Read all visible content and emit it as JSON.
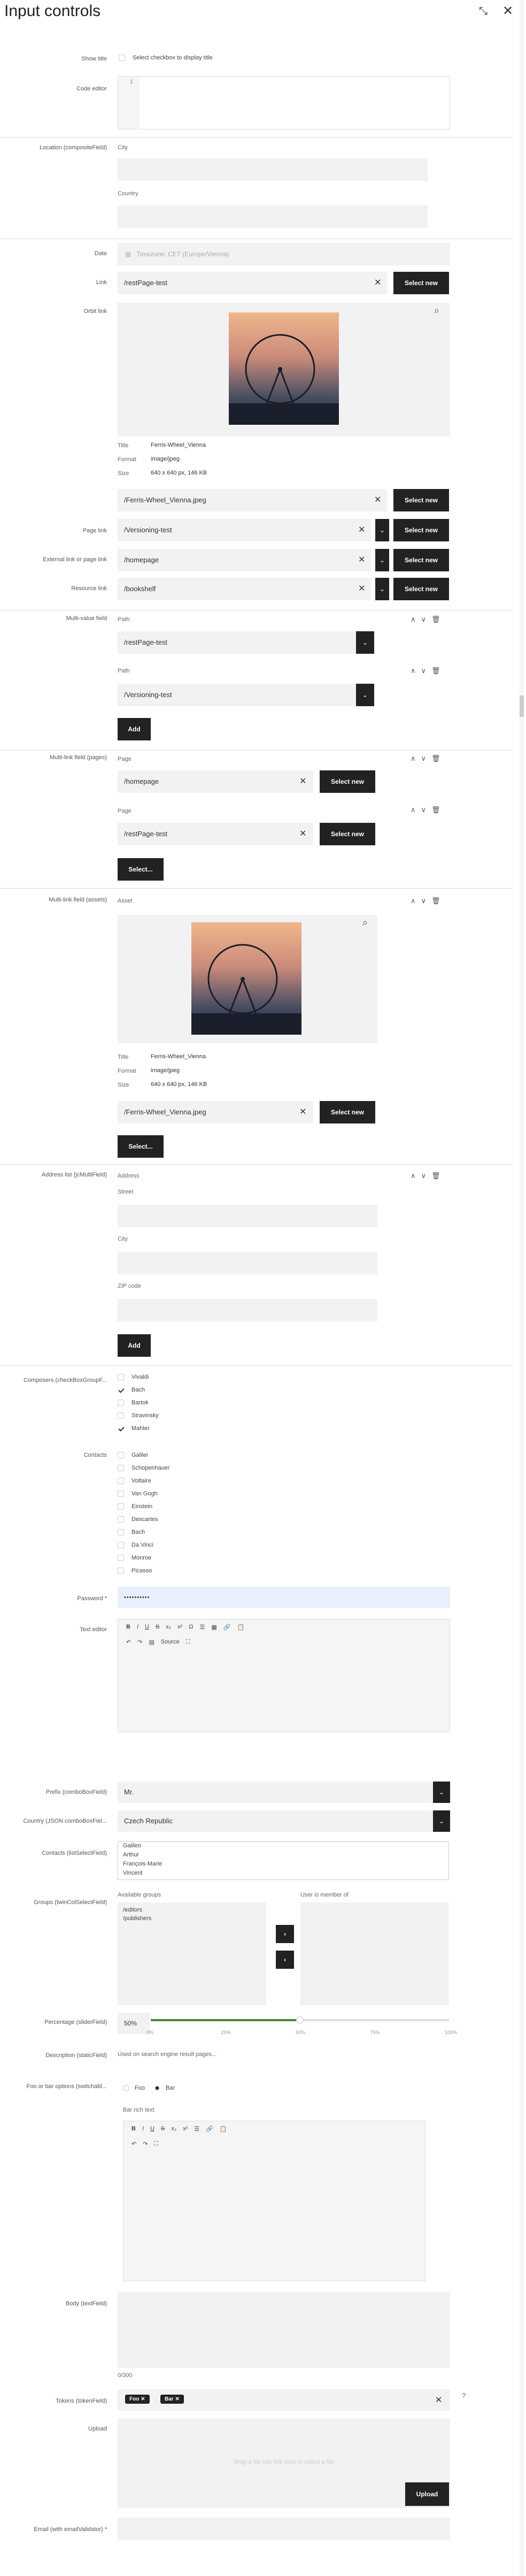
{
  "header": {
    "title": "Input controls"
  },
  "labels": {
    "show_title": "Show title",
    "code_editor": "Code editor",
    "location": "Location (compositeField)",
    "date": "Date",
    "link": "Link",
    "orbit_link": "Orbit link",
    "page_link": "Page link",
    "external_link": "External link or page link",
    "resource_link": "Resource link",
    "multivalue": "Multi-value field",
    "multilink_pages": "Multi-link field (pages)",
    "multilink_assets": "Multi-link field (assets)",
    "address_list": "Address list (jcMultiField)",
    "composers": "Composers (checkBoxGroupF...",
    "contacts": "Contacts",
    "password": "Password *",
    "text_editor": "Text editor",
    "prefix": "Prefix (comboBoxField)",
    "country": "Country (JSON comboBoxFiel...",
    "contacts_select": "Contacts (listSelectField)",
    "groups": "Groups (twinColSelectField)",
    "percentage": "Percentage (sliderField)",
    "description": "Description (staticField)",
    "foo_bar": "Foo or bar options (switchabl...",
    "body": "Body (textField)",
    "tokens": "Tokens (tokenField)",
    "upload": "Upload",
    "email": "Email (with emailValidator) *"
  },
  "show_title": {
    "checkbox_label": "Select checkbox to display title"
  },
  "code_editor": {
    "line": "1"
  },
  "location": {
    "city": "City",
    "country": "Country"
  },
  "date": {
    "placeholder": "Timezone: CET (Europe/Vienna)"
  },
  "link": {
    "value": "/restPage-test",
    "button": "Select new"
  },
  "asset": {
    "title_k": "Title",
    "title_v": "Ferris-Wheel_Vienna",
    "format_k": "Format",
    "format_v": "image/jpeg",
    "size_k": "Size",
    "size_v": "640 x 640 px, 146 KB",
    "path": "/Ferris-Wheel_Vienna.jpeg",
    "button": "Select new"
  },
  "page_link": {
    "value": "/Versioning-test",
    "button": "Select new"
  },
  "external_link": {
    "value": "/homepage",
    "button": "Select new"
  },
  "resource_link": {
    "value": "/bookshelf",
    "button": "Select new"
  },
  "multivalue": {
    "path1": "Path",
    "value1": "/restPage-test",
    "path2": "Path",
    "value2": "/Versioning-test",
    "add": "Add"
  },
  "multilink_pages": {
    "label1": "Page",
    "value1": "/homepage",
    "label2": "Page",
    "value2": "/restPage-test",
    "button": "Select new",
    "select": "Select..."
  },
  "multilink_assets": {
    "label": "Asset",
    "select": "Select..."
  },
  "address": {
    "address": "Address",
    "street": "Street",
    "city": "City",
    "zip": "ZIP code",
    "add": "Add"
  },
  "composers": [
    {
      "name": "Vivaldi",
      "checked": false
    },
    {
      "name": "Bach",
      "checked": true
    },
    {
      "name": "Bartok",
      "checked": false
    },
    {
      "name": "Stravinsky",
      "checked": false
    },
    {
      "name": "Mahler",
      "checked": true
    }
  ],
  "contacts": [
    "Galilei",
    "Schopenhauer",
    "Voltaire",
    "Van Gogh",
    "Einstein",
    "Descartes",
    "Bach",
    "Da Vinci",
    "Monroe",
    "Picasso"
  ],
  "password": {
    "value": "••••••••••"
  },
  "text_editor": {
    "source": "Source"
  },
  "prefix": {
    "value": "Mr."
  },
  "country": {
    "value": "Czech Republic"
  },
  "contacts_select": [
    "Galileo",
    "Arthur",
    "François-Marie",
    "Vincent"
  ],
  "groups": {
    "available": "Available groups",
    "member": "User is member of",
    "items": [
      "/editors",
      "/publishers"
    ]
  },
  "percentage": {
    "value": "50%",
    "ticks": [
      "0%",
      "25%",
      "50%",
      "75%",
      "100%"
    ],
    "level": 0.5
  },
  "description": {
    "text": "Used on search engine result pages..."
  },
  "foo_bar": {
    "foo": "Foo",
    "bar": "Bar",
    "rich": "Bar rich text"
  },
  "body": {
    "counter": "0/300"
  },
  "tokens": {
    "t1": "Foo",
    "t2": "Bar"
  },
  "upload": {
    "hint": "Drag a file into this area or select a file",
    "button": "Upload"
  },
  "colors": {
    "dark": "#222222",
    "accent": "#4a8a2a",
    "input": "#f2f2f2",
    "password_bg": "#e8f0fe"
  }
}
